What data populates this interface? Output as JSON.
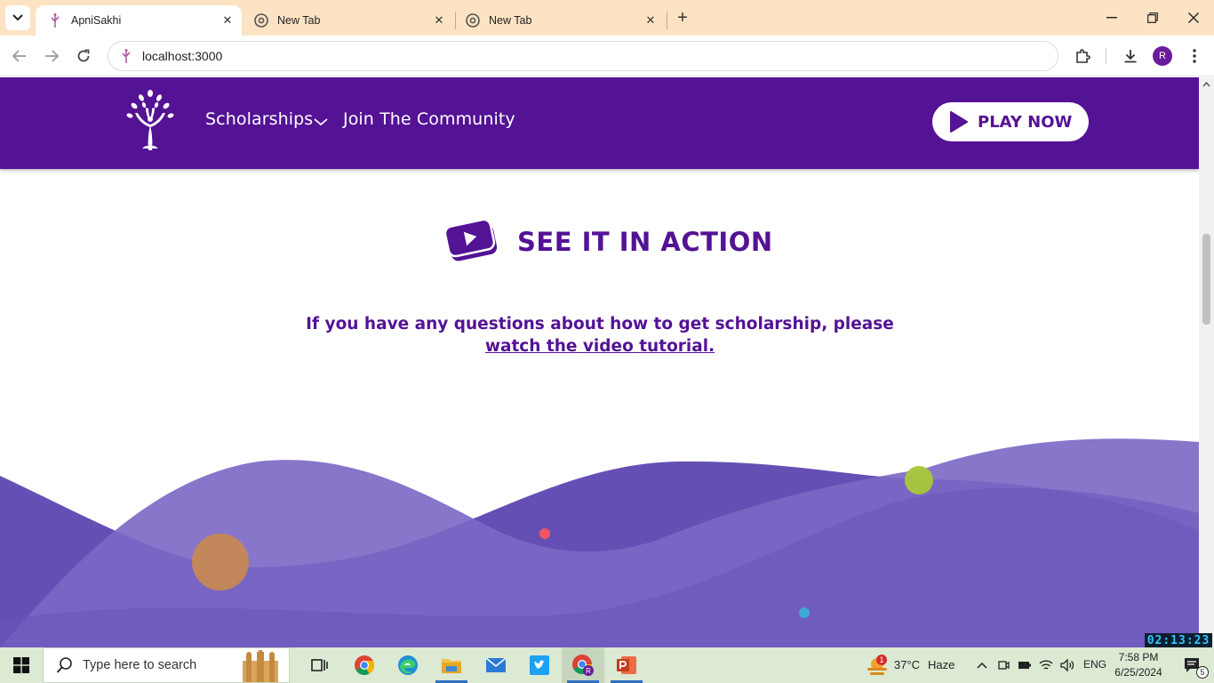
{
  "browser": {
    "tabs": [
      {
        "title": "ApniSakhi",
        "active": true
      },
      {
        "title": "New Tab",
        "active": false
      },
      {
        "title": "New Tab",
        "active": false
      }
    ],
    "url": "localhost:3000",
    "profile_initial": "R"
  },
  "site": {
    "nav": {
      "scholarships": "Scholarships",
      "community": "Join The Community",
      "play_now": "PLAY NOW"
    },
    "section": {
      "title": "SEE IT IN ACTION",
      "desc_prefix": "If you have any questions about how to get scholarship, please ",
      "desc_link": "watch the video tutorial."
    },
    "colors": {
      "brand_purple": "#541295",
      "wave_light": "#8e7fcf",
      "wave_dark": "#6a55b7"
    }
  },
  "overlay_timer": "02:13:23",
  "taskbar": {
    "search_placeholder": "Type here to search",
    "weather": {
      "temp": "37°C",
      "condition": "Haze",
      "badge": "1"
    },
    "language": "ENG",
    "time": "7:58 PM",
    "date": "6/25/2024",
    "notification_count": "5"
  }
}
